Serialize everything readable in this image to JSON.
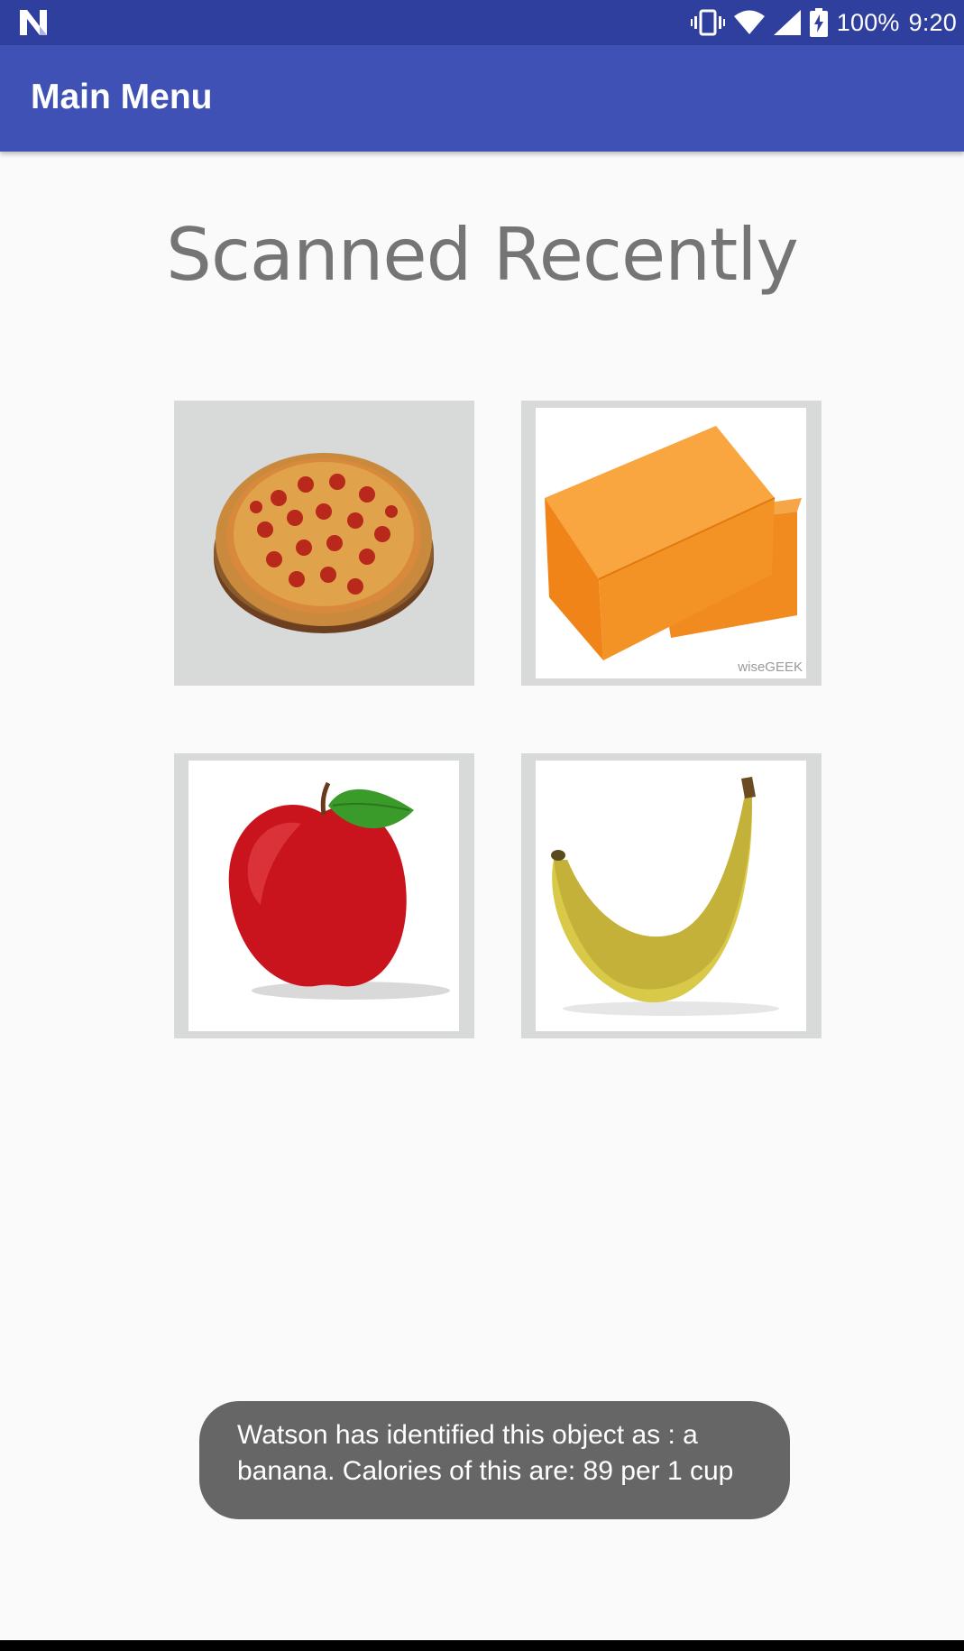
{
  "status_bar": {
    "battery": "100%",
    "time": "9:20"
  },
  "app_bar": {
    "title": "Main Menu"
  },
  "main": {
    "heading": "Scanned Recently",
    "items": [
      {
        "name": "pizza"
      },
      {
        "name": "cheese",
        "watermark": "wiseGEEK"
      },
      {
        "name": "apple"
      },
      {
        "name": "banana"
      }
    ]
  },
  "toast": {
    "message": "Watson has identified this object as : a banana. Calories of this are: 89 per 1 cup"
  },
  "colors": {
    "status_bar": "#2f3f9e",
    "app_bar": "#3f51b5",
    "toast": "#666666"
  }
}
